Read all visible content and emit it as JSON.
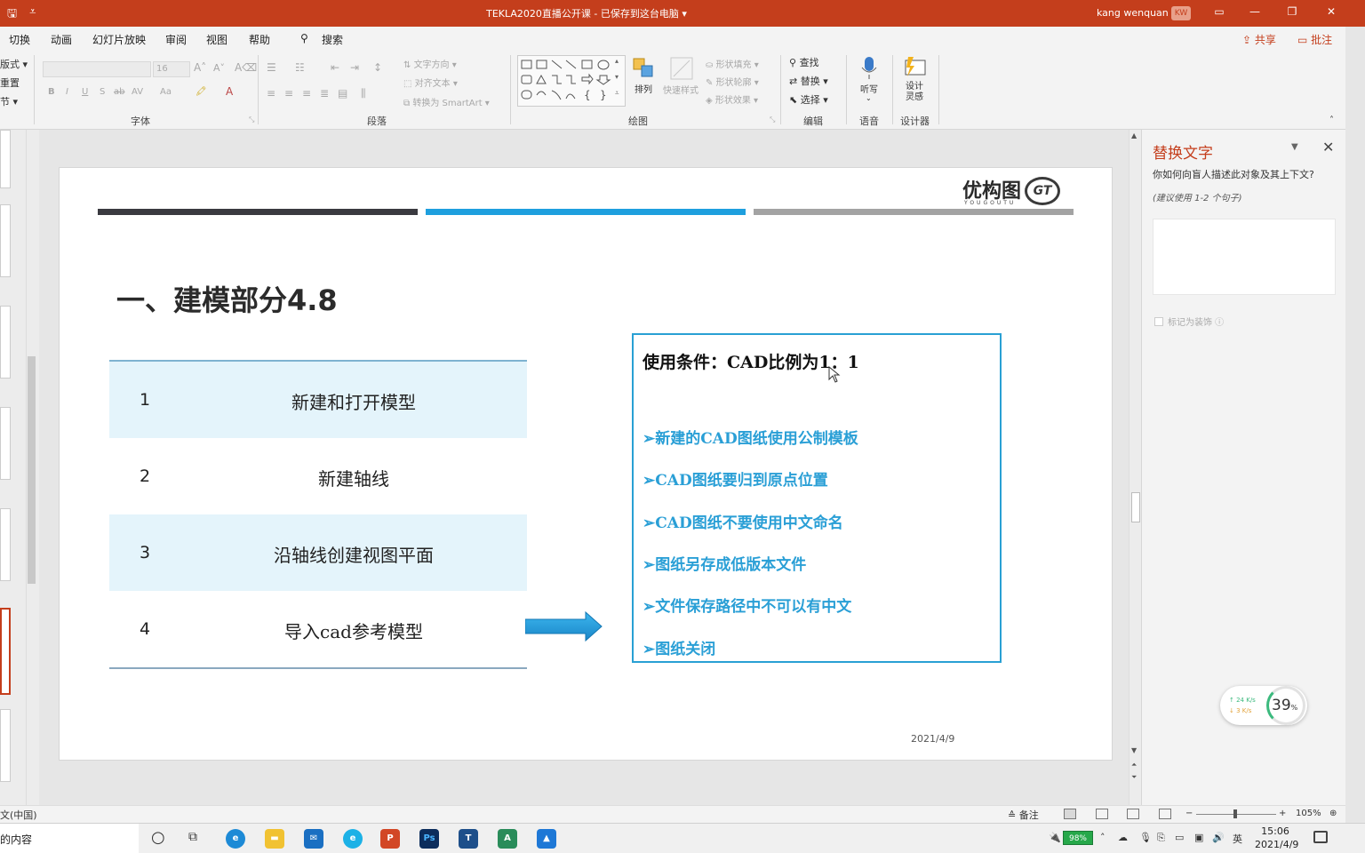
{
  "titlebar": {
    "title": "TEKLA2020直播公开课 - 已保存到这台电脑 ▾",
    "user": "kang wenquan",
    "avatar": "KW",
    "icons": [
      "save-icon",
      "qat-dropdown-icon",
      "ribbon-display-icon",
      "minimize-icon",
      "restore-icon",
      "close-icon"
    ]
  },
  "menu": {
    "tabs": [
      "切换",
      "动画",
      "幻灯片放映",
      "审阅",
      "视图",
      "帮助"
    ],
    "search": "搜索",
    "share": "共享",
    "comment": "批注"
  },
  "ribbon": {
    "clipped": [
      "版式 ▾",
      "重置",
      "节 ▾"
    ],
    "font_size": "16",
    "font_buttons": [
      "B",
      "I",
      "U",
      "S",
      "ab",
      "AV",
      "Aa",
      "A",
      "A"
    ],
    "text_direction": "文字方向 ▾",
    "align_text": "对齐文本 ▾",
    "smartart": "转换为 SmartArt ▾",
    "arrange": "排列",
    "quick_styles": "快速样式",
    "shape_fill": "形状填充 ▾",
    "shape_outline": "形状轮廓 ▾",
    "shape_effects": "形状效果 ▾",
    "find": "查找",
    "replace": "替换 ▾",
    "select": "选择 ▾",
    "dictate": "听写",
    "designer": "设计灵感",
    "groups": {
      "font": "字体",
      "paragraph": "段落",
      "drawing": "绘图",
      "editing": "编辑",
      "voice": "语音",
      "designer": "设计器"
    }
  },
  "slide": {
    "logo": "优构图",
    "logo_sub": "YOUGOUTU",
    "logo_mark": "GT",
    "title": "一、建模部分4.8",
    "steps": [
      {
        "num": "1",
        "text": "新建和打开模型"
      },
      {
        "num": "2",
        "text": "新建轴线"
      },
      {
        "num": "3",
        "text": "沿轴线创建视图平面"
      },
      {
        "num": "4",
        "text": "导入cad参考模型"
      }
    ],
    "condition_title": "使用条件：CAD比例为1：1",
    "conditions": [
      "➢新建的CAD图纸使用公制模板",
      "➢CAD图纸要归到原点位置",
      "➢CAD图纸不要使用中文命名",
      "➢图纸另存成低版本文件",
      "➢文件保存路径中不可以有中文",
      "➢图纸关闭"
    ],
    "date": "2021/4/9",
    "colors": {
      "bar1": "#3a3a40",
      "bar2": "#1e9fde",
      "bar3": "#a3a3a3",
      "accent": "#2a9fd6"
    }
  },
  "pane": {
    "title": "替换文字",
    "question": "你如何向盲人描述此对象及其上下文?",
    "hint": "(建议使用 1-2 个句子)",
    "decorative": "标记为装饰 ⓘ",
    "net_up": "↑ 24 K/s",
    "net_down": "↓ 3  K/s",
    "net_pct": "39",
    "net_pct_unit": "%"
  },
  "status": {
    "language": "文(中国)",
    "notes": "≙ 备注",
    "zoom_minus": "−",
    "zoom_plus": "+",
    "zoom": "105%"
  },
  "taskbar": {
    "search": "的内容",
    "battery": "98%",
    "ime": "英",
    "time": "15:06",
    "date": "2021/4/9",
    "apps": [
      "edge-icon",
      "file-explorer-icon",
      "mail-icon",
      "browser-icon",
      "powerpoint-icon",
      "photoshop-icon",
      "tekla-icon",
      "acad-icon",
      "app-icon"
    ]
  }
}
